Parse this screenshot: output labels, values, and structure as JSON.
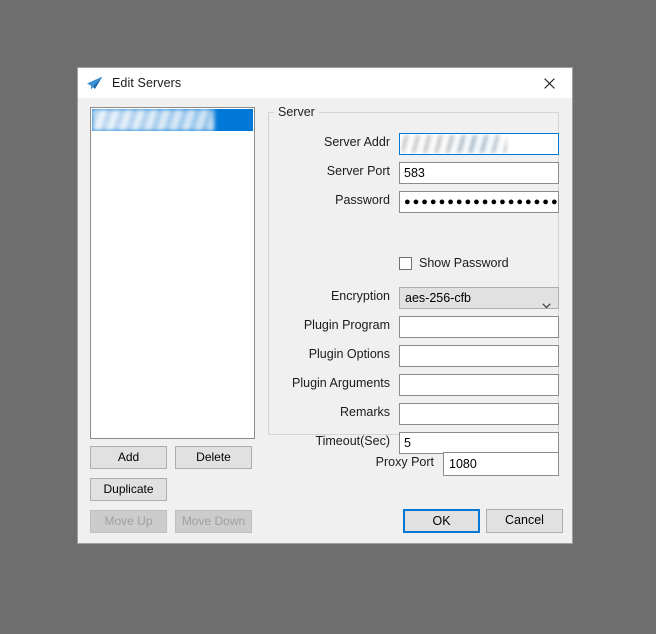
{
  "window": {
    "title": "Edit Servers",
    "icon": "paper-plane-icon",
    "close_label": "✕",
    "accent_color": "#0078d7",
    "background_color": "#6e6e6e",
    "chrome_color": "#f0f0f0"
  },
  "server_list": {
    "items": [
      {
        "label": "",
        "redacted": true,
        "selected": true
      }
    ]
  },
  "list_buttons": {
    "add": "Add",
    "delete": "Delete",
    "duplicate": "Duplicate",
    "move_up": "Move Up",
    "move_down": "Move Down",
    "move_up_enabled": false,
    "move_down_enabled": false
  },
  "server_group": {
    "title": "Server",
    "fields": [
      {
        "label": "Server Addr",
        "value": "",
        "redacted": true,
        "focused": true,
        "type": "text"
      },
      {
        "label": "Server Port",
        "value": "583",
        "redacted": false,
        "focused": false,
        "type": "text"
      },
      {
        "label": "Password",
        "value": "●●●●●●●●●●●●●●●●●●●●●●",
        "redacted": false,
        "focused": false,
        "type": "password"
      },
      {
        "label": "Encryption",
        "value": "aes-256-cfb",
        "redacted": false,
        "focused": false,
        "type": "select"
      },
      {
        "label": "Plugin Program",
        "value": "",
        "redacted": false,
        "focused": false,
        "type": "text"
      },
      {
        "label": "Plugin Options",
        "value": "",
        "redacted": false,
        "focused": false,
        "type": "text"
      },
      {
        "label": "Plugin Arguments",
        "value": "",
        "redacted": false,
        "focused": false,
        "type": "text"
      },
      {
        "label": "Remarks",
        "value": "",
        "redacted": false,
        "focused": false,
        "type": "text"
      },
      {
        "label": "Timeout(Sec)",
        "value": "5",
        "redacted": false,
        "focused": false,
        "type": "text"
      }
    ],
    "show_password": {
      "label": "Show Password",
      "checked": false
    }
  },
  "proxy": {
    "label": "Proxy Port",
    "value": "1080"
  },
  "dialog_buttons": {
    "ok": "OK",
    "cancel": "Cancel"
  }
}
